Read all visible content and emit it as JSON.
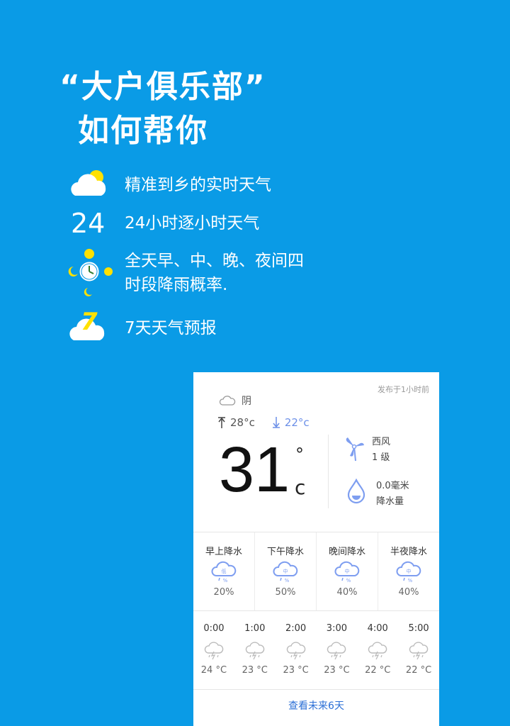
{
  "headline": {
    "line1": "“大户俱乐部”",
    "line2": "如何帮你"
  },
  "features": [
    {
      "icon": "cloud-sun-icon",
      "text": "精准到乡的实时天气"
    },
    {
      "icon": "hours-24-icon",
      "icon_text": "24",
      "text": "24小时逐小时天气"
    },
    {
      "icon": "clock-sun-moon-icon",
      "text": "全天早、中、晚、夜间四\n时段降雨概率."
    },
    {
      "icon": "cloud-seven-icon",
      "icon_text": "7",
      "text": "7天天气预报"
    }
  ],
  "card": {
    "published": "发布于1小时前",
    "condition": "阴",
    "high": "28°c",
    "low": "22°c",
    "temp": "31",
    "deg": "°",
    "unit": "c",
    "wind_dir": "西风",
    "wind_level": "1 级",
    "precip_amount": "0.0毫米",
    "precip_label": "降水量",
    "periods": [
      {
        "name": "早上降水",
        "level": "低",
        "pct": "20%"
      },
      {
        "name": "下午降水",
        "level": "中",
        "pct": "50%"
      },
      {
        "name": "晚间降水",
        "level": "中",
        "pct": "40%"
      },
      {
        "name": "半夜降水",
        "level": "中",
        "pct": "40%"
      }
    ],
    "hours": [
      {
        "time": "0:00",
        "temp": "24 °C"
      },
      {
        "time": "1:00",
        "temp": "23 °C"
      },
      {
        "time": "2:00",
        "temp": "23 °C"
      },
      {
        "time": "3:00",
        "temp": "23 °C"
      },
      {
        "time": "4:00",
        "temp": "22 °C"
      },
      {
        "time": "5:00",
        "temp": "22 °C"
      }
    ],
    "more_link": "查看未来6天"
  },
  "colors": {
    "background": "#0a9be6",
    "accent_yellow": "#ffe100",
    "low_temp": "#6b8fe8",
    "icon_blue": "#7e9ef0",
    "link": "#2b6fd6"
  }
}
